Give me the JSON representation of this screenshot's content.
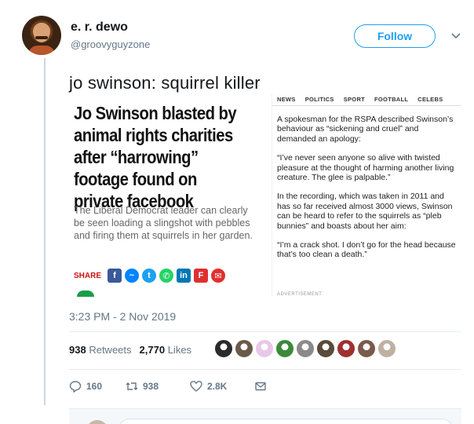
{
  "user": {
    "display_name": "e. r. dewo",
    "handle": "@groovyguyzone",
    "follow_label": "Follow"
  },
  "tweet": {
    "text": "jo swinson: squirrel killer",
    "timestamp": "3:23 PM - 2 Nov 2019"
  },
  "article": {
    "headline": "Jo Swinson blasted by animal rights charities after “harrowing” footage found on private facebook",
    "standfirst": "The Liberal Democrat leader can clearly be seen loading a slingshot with pebbles and firing them at squirrels in her garden.",
    "share_label": "SHARE",
    "nav": [
      "NEWS",
      "POLITICS",
      "SPORT",
      "FOOTBALL",
      "CELEBS"
    ],
    "paragraphs": [
      "A spokesman for the RSPA described Swinson’s behaviour as “sickening and cruel” and demanded an apology:",
      "“I’ve never seen anyone so alive with twisted pleasure at the thought of harming another living creature. The glee is palpable.”",
      "In the recording, which was taken in 2011 and has so far received almost 3000 views, Swinson can be heard to refer to the squirrels as “pleb bunnies” and boasts about her aim:",
      "“I’m a crack shot. I don’t go for the head because that’s too clean a death.”"
    ],
    "advert_label": "ADVERTISEMENT"
  },
  "stats": {
    "retweets_count": "938",
    "retweets_label": "Retweets",
    "likes_count": "2,770",
    "likes_label": "Likes"
  },
  "likers": [
    "#2b2b2b",
    "#6b5a4a",
    "#e8c8e8",
    "#3a8a3a",
    "#8a8a8a",
    "#5a4a3a",
    "#a03030",
    "#7a5a4a",
    "#c0b0a0"
  ],
  "actions": {
    "replies": "160",
    "retweets": "938",
    "likes": "2.8K"
  },
  "colors": {
    "accent": "#1da1f2",
    "muted": "#657786",
    "share_red": "#c11"
  }
}
